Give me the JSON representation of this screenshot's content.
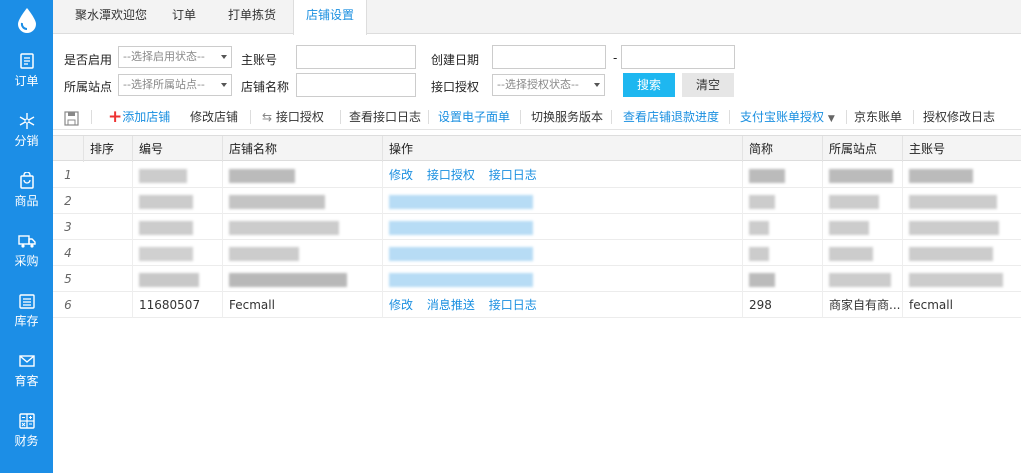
{
  "tabs": [
    "聚水潭欢迎您",
    "订单",
    "打单拣货",
    "店铺设置"
  ],
  "sidebar": [
    {
      "label": "订单",
      "icon": "document-icon"
    },
    {
      "label": "分销",
      "icon": "snowflake-icon"
    },
    {
      "label": "商品",
      "icon": "bag-icon"
    },
    {
      "label": "采购",
      "icon": "truck-icon"
    },
    {
      "label": "库存",
      "icon": "warehouse-icon"
    },
    {
      "label": "育客",
      "icon": "mail-icon"
    },
    {
      "label": "财务",
      "icon": "calculator-icon"
    }
  ],
  "filters": {
    "enabled_label": "是否启用",
    "enabled_placeholder": "--选择启用状态--",
    "main_account_label": "主账号",
    "created_date_label": "创建日期",
    "date_separator": "-",
    "site_label": "所属站点",
    "site_placeholder": "--选择所属站点--",
    "shop_name_label": "店铺名称",
    "auth_label": "接口授权",
    "auth_placeholder": "--选择授权状态--",
    "search_button": "搜索",
    "clear_button": "清空"
  },
  "toolbar": {
    "add_shop": "添加店铺",
    "edit_shop": "修改店铺",
    "api_auth": "接口授权",
    "view_api_log": "查看接口日志",
    "set_eform": "设置电子面单",
    "switch_version": "切换服务版本",
    "refund_progress": "查看店铺退款进度",
    "alipay_auth": "支付宝账单授权",
    "jd_bill": "京东账单",
    "auth_change_log": "授权修改日志"
  },
  "table": {
    "headers": [
      "排序",
      "编号",
      "店铺名称",
      "操作",
      "简称",
      "所属站点",
      "主账号"
    ],
    "row_numbers": [
      "1",
      "2",
      "3",
      "4",
      "5",
      "6"
    ],
    "visible_row": {
      "id": "11680507",
      "name": "Fecmall",
      "actions": [
        "修改",
        "消息推送",
        "接口日志"
      ],
      "short": "298",
      "site": "商家自有商...",
      "account": "fecmall"
    },
    "partial_actions_row1": [
      "修改",
      "接口授权",
      "接口日志"
    ]
  },
  "colors": {
    "sidebar": "#1c8ee6",
    "link": "#1a8fe0",
    "primary_button": "#1eb7f0"
  }
}
